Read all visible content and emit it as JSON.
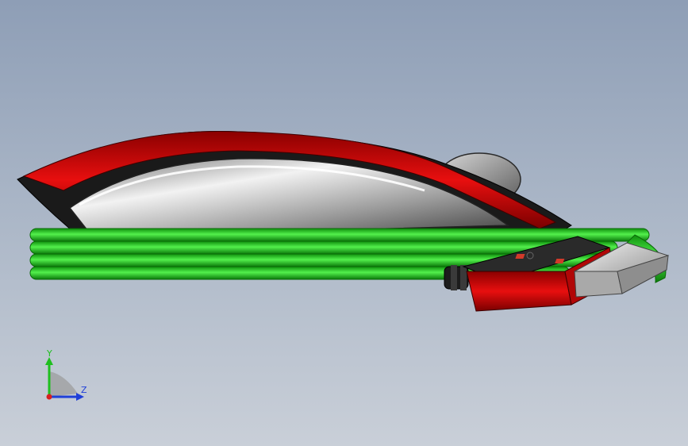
{
  "viewport": {
    "background_top": "#8e9eb6",
    "background_bottom": "#c9cfd8"
  },
  "model": {
    "cable_color": "#2ee02a",
    "shell_color": "#e00a0a",
    "body_color": "#b9b9b9",
    "connector_metal": "#c8c8c8"
  },
  "triad": {
    "y_label": "Y",
    "z_label": "Z",
    "y_color": "#1fbf1f",
    "z_color": "#1f3fd8",
    "x_color": "#d81f1f"
  }
}
